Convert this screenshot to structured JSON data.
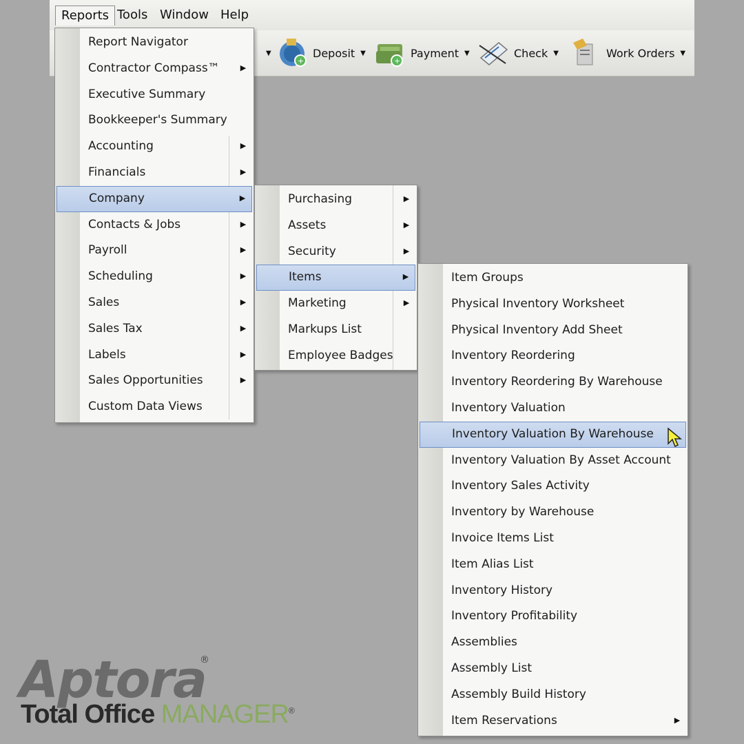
{
  "menubar": {
    "items": [
      {
        "label": "Reports",
        "open": true
      },
      {
        "label": "Tools"
      },
      {
        "label": "Window"
      },
      {
        "label": "Help"
      }
    ]
  },
  "toolbar": {
    "buttons": [
      {
        "label": "Deposit",
        "icon": "deposit-icon"
      },
      {
        "label": "Payment",
        "icon": "payment-icon"
      },
      {
        "label": "Check",
        "icon": "check-icon"
      },
      {
        "label": "Work Orders",
        "icon": "work-orders-icon"
      }
    ]
  },
  "reports_menu": {
    "items": [
      {
        "label": "Report Navigator",
        "submenu": false
      },
      {
        "label": "Contractor Compass™",
        "submenu": true
      },
      {
        "label": "Executive Summary",
        "submenu": false
      },
      {
        "label": "Bookkeeper's Summary",
        "submenu": false
      },
      {
        "label": "Accounting",
        "submenu": true
      },
      {
        "label": "Financials",
        "submenu": true
      },
      {
        "label": "Company",
        "submenu": true,
        "highlighted": true
      },
      {
        "label": "Contacts & Jobs",
        "submenu": true
      },
      {
        "label": "Payroll",
        "submenu": true
      },
      {
        "label": "Scheduling",
        "submenu": true
      },
      {
        "label": "Sales",
        "submenu": true
      },
      {
        "label": "Sales Tax",
        "submenu": true
      },
      {
        "label": "Labels",
        "submenu": true
      },
      {
        "label": "Sales Opportunities",
        "submenu": true
      },
      {
        "label": "Custom Data Views",
        "submenu": false
      }
    ]
  },
  "company_menu": {
    "items": [
      {
        "label": "Purchasing",
        "submenu": true
      },
      {
        "label": "Assets",
        "submenu": true
      },
      {
        "label": "Security",
        "submenu": true
      },
      {
        "label": "Items",
        "submenu": true,
        "highlighted": true
      },
      {
        "label": "Marketing",
        "submenu": true
      },
      {
        "label": "Markups List",
        "submenu": false
      },
      {
        "label": "Employee Badges",
        "submenu": false
      }
    ]
  },
  "items_menu": {
    "items": [
      {
        "label": "Item Groups",
        "submenu": false
      },
      {
        "label": "Physical Inventory Worksheet",
        "submenu": false
      },
      {
        "label": "Physical Inventory Add Sheet",
        "submenu": false
      },
      {
        "label": "Inventory Reordering",
        "submenu": false
      },
      {
        "label": "Inventory Reordering By Warehouse",
        "submenu": false
      },
      {
        "label": "Inventory Valuation",
        "submenu": false
      },
      {
        "label": "Inventory Valuation By Warehouse",
        "submenu": false,
        "highlighted": true
      },
      {
        "label": "Inventory Valuation By Asset Account",
        "submenu": false
      },
      {
        "label": "Inventory Sales Activity",
        "submenu": false
      },
      {
        "label": "Inventory by Warehouse",
        "submenu": false
      },
      {
        "label": "Invoice Items List",
        "submenu": false
      },
      {
        "label": "Item Alias List",
        "submenu": false
      },
      {
        "label": "Inventory History",
        "submenu": false
      },
      {
        "label": "Inventory Profitability",
        "submenu": false
      },
      {
        "label": "Assemblies",
        "submenu": false
      },
      {
        "label": "Assembly List",
        "submenu": false
      },
      {
        "label": "Assembly Build History",
        "submenu": false
      },
      {
        "label": "Item Reservations",
        "submenu": true
      }
    ]
  },
  "logo": {
    "brand": "Aptora",
    "reg": "®",
    "product_prefix": "Total Office ",
    "product_suffix": "MANAGER"
  },
  "colors": {
    "highlight": "#b9cce9",
    "logo_gray": "#6b6b6b",
    "logo_green": "#8aaa60"
  }
}
